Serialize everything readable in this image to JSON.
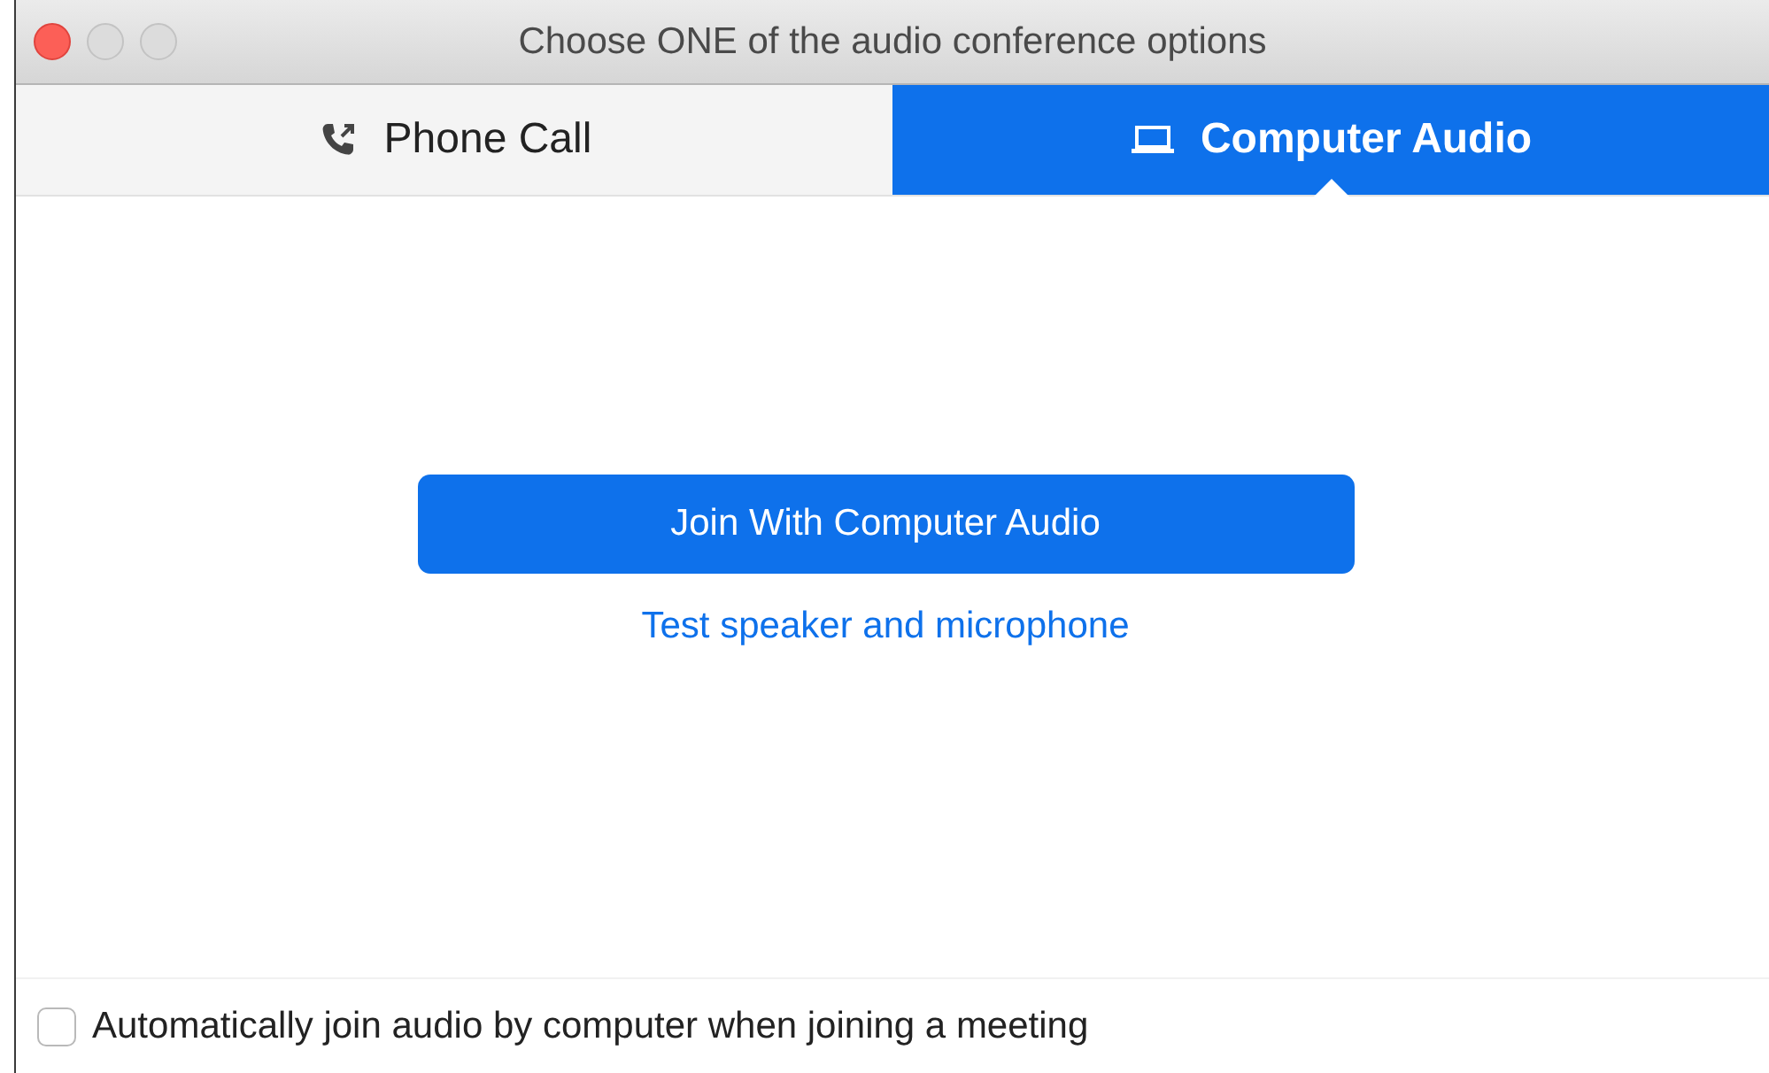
{
  "window": {
    "title": "Choose ONE of the audio conference options"
  },
  "tabs": [
    {
      "label": "Phone Call",
      "kind": "phone",
      "selected": false
    },
    {
      "label": "Computer Audio",
      "kind": "computer",
      "selected": true
    }
  ],
  "join_button": {
    "label": "Join With Computer Audio"
  },
  "test_link": {
    "label": "Test speaker and microphone"
  },
  "auto_join": {
    "label": "Automatically join audio by computer when joining a meeting",
    "checked": false
  }
}
